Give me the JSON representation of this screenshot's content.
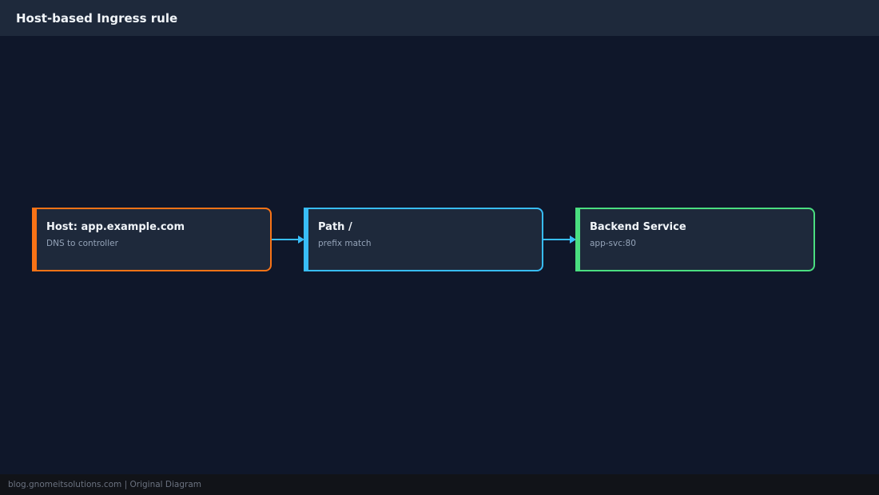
{
  "header": {
    "title": "Host-based Ingress rule"
  },
  "nodes": [
    {
      "title": "Host: app.example.com",
      "subtitle": "DNS to controller",
      "color": "#f97316"
    },
    {
      "title": "Path /",
      "subtitle": "prefix match",
      "color": "#38bdf8"
    },
    {
      "title": "Backend Service",
      "subtitle": "app-svc:80",
      "color": "#4ade80"
    }
  ],
  "edges": [
    {
      "from": 0,
      "to": 1,
      "color": "#38bdf8"
    },
    {
      "from": 1,
      "to": 2,
      "color": "#38bdf8"
    }
  ],
  "footer": {
    "text": "blog.gnomeitsolutions.com | Original Diagram"
  }
}
